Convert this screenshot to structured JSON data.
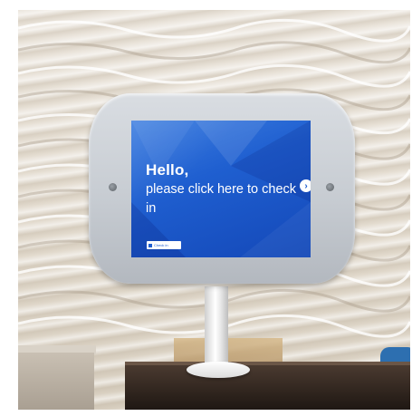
{
  "kiosk": {
    "greeting": "Hello,",
    "prompt": "please click here to check in",
    "next_button_glyph": "›",
    "small_button_label": "Check in"
  },
  "colors": {
    "screen_blue": "#1f5fd0",
    "enclosure_gray": "#c7ccd2",
    "wall_cream": "#e4ddd2",
    "desk_brown": "#2b211b"
  },
  "icons": {
    "next": "chevron-right-icon"
  }
}
